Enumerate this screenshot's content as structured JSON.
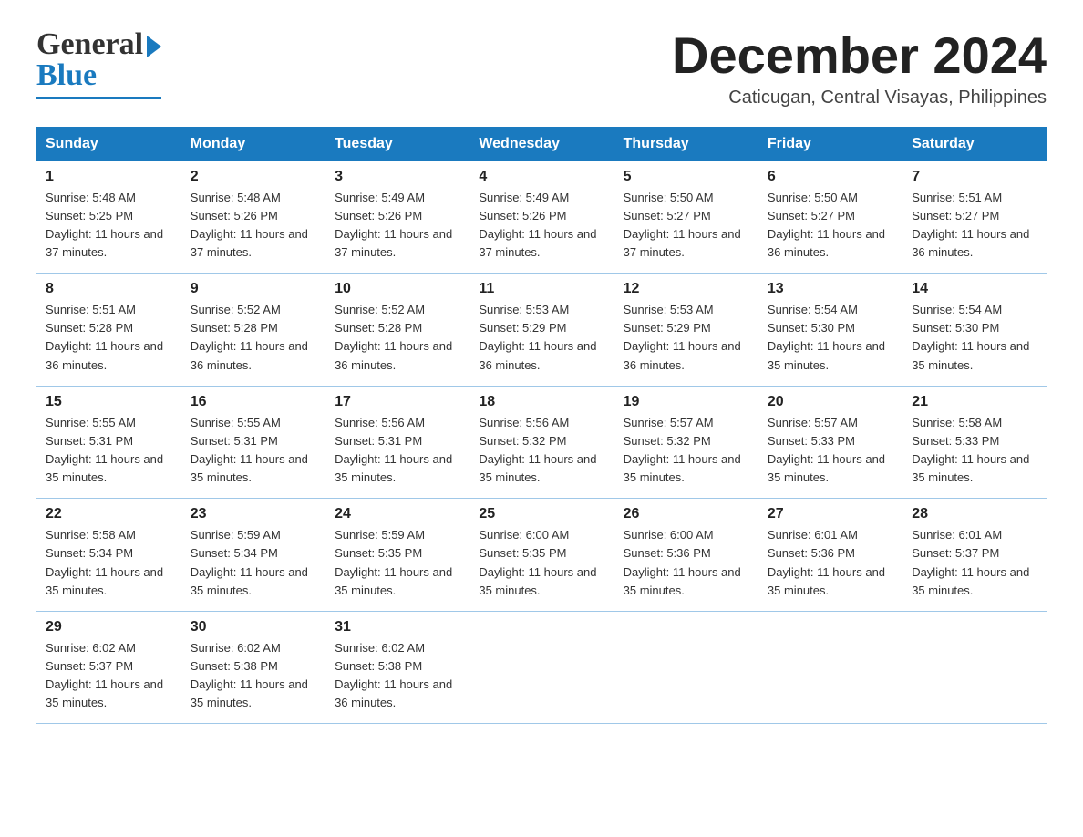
{
  "header": {
    "logo_general": "General",
    "logo_blue": "Blue",
    "month_title": "December 2024",
    "location": "Caticugan, Central Visayas, Philippines"
  },
  "columns": [
    "Sunday",
    "Monday",
    "Tuesday",
    "Wednesday",
    "Thursday",
    "Friday",
    "Saturday"
  ],
  "weeks": [
    [
      {
        "day": "1",
        "sunrise": "5:48 AM",
        "sunset": "5:25 PM",
        "daylight": "11 hours and 37 minutes."
      },
      {
        "day": "2",
        "sunrise": "5:48 AM",
        "sunset": "5:26 PM",
        "daylight": "11 hours and 37 minutes."
      },
      {
        "day": "3",
        "sunrise": "5:49 AM",
        "sunset": "5:26 PM",
        "daylight": "11 hours and 37 minutes."
      },
      {
        "day": "4",
        "sunrise": "5:49 AM",
        "sunset": "5:26 PM",
        "daylight": "11 hours and 37 minutes."
      },
      {
        "day": "5",
        "sunrise": "5:50 AM",
        "sunset": "5:27 PM",
        "daylight": "11 hours and 37 minutes."
      },
      {
        "day": "6",
        "sunrise": "5:50 AM",
        "sunset": "5:27 PM",
        "daylight": "11 hours and 36 minutes."
      },
      {
        "day": "7",
        "sunrise": "5:51 AM",
        "sunset": "5:27 PM",
        "daylight": "11 hours and 36 minutes."
      }
    ],
    [
      {
        "day": "8",
        "sunrise": "5:51 AM",
        "sunset": "5:28 PM",
        "daylight": "11 hours and 36 minutes."
      },
      {
        "day": "9",
        "sunrise": "5:52 AM",
        "sunset": "5:28 PM",
        "daylight": "11 hours and 36 minutes."
      },
      {
        "day": "10",
        "sunrise": "5:52 AM",
        "sunset": "5:28 PM",
        "daylight": "11 hours and 36 minutes."
      },
      {
        "day": "11",
        "sunrise": "5:53 AM",
        "sunset": "5:29 PM",
        "daylight": "11 hours and 36 minutes."
      },
      {
        "day": "12",
        "sunrise": "5:53 AM",
        "sunset": "5:29 PM",
        "daylight": "11 hours and 36 minutes."
      },
      {
        "day": "13",
        "sunrise": "5:54 AM",
        "sunset": "5:30 PM",
        "daylight": "11 hours and 35 minutes."
      },
      {
        "day": "14",
        "sunrise": "5:54 AM",
        "sunset": "5:30 PM",
        "daylight": "11 hours and 35 minutes."
      }
    ],
    [
      {
        "day": "15",
        "sunrise": "5:55 AM",
        "sunset": "5:31 PM",
        "daylight": "11 hours and 35 minutes."
      },
      {
        "day": "16",
        "sunrise": "5:55 AM",
        "sunset": "5:31 PM",
        "daylight": "11 hours and 35 minutes."
      },
      {
        "day": "17",
        "sunrise": "5:56 AM",
        "sunset": "5:31 PM",
        "daylight": "11 hours and 35 minutes."
      },
      {
        "day": "18",
        "sunrise": "5:56 AM",
        "sunset": "5:32 PM",
        "daylight": "11 hours and 35 minutes."
      },
      {
        "day": "19",
        "sunrise": "5:57 AM",
        "sunset": "5:32 PM",
        "daylight": "11 hours and 35 minutes."
      },
      {
        "day": "20",
        "sunrise": "5:57 AM",
        "sunset": "5:33 PM",
        "daylight": "11 hours and 35 minutes."
      },
      {
        "day": "21",
        "sunrise": "5:58 AM",
        "sunset": "5:33 PM",
        "daylight": "11 hours and 35 minutes."
      }
    ],
    [
      {
        "day": "22",
        "sunrise": "5:58 AM",
        "sunset": "5:34 PM",
        "daylight": "11 hours and 35 minutes."
      },
      {
        "day": "23",
        "sunrise": "5:59 AM",
        "sunset": "5:34 PM",
        "daylight": "11 hours and 35 minutes."
      },
      {
        "day": "24",
        "sunrise": "5:59 AM",
        "sunset": "5:35 PM",
        "daylight": "11 hours and 35 minutes."
      },
      {
        "day": "25",
        "sunrise": "6:00 AM",
        "sunset": "5:35 PM",
        "daylight": "11 hours and 35 minutes."
      },
      {
        "day": "26",
        "sunrise": "6:00 AM",
        "sunset": "5:36 PM",
        "daylight": "11 hours and 35 minutes."
      },
      {
        "day": "27",
        "sunrise": "6:01 AM",
        "sunset": "5:36 PM",
        "daylight": "11 hours and 35 minutes."
      },
      {
        "day": "28",
        "sunrise": "6:01 AM",
        "sunset": "5:37 PM",
        "daylight": "11 hours and 35 minutes."
      }
    ],
    [
      {
        "day": "29",
        "sunrise": "6:02 AM",
        "sunset": "5:37 PM",
        "daylight": "11 hours and 35 minutes."
      },
      {
        "day": "30",
        "sunrise": "6:02 AM",
        "sunset": "5:38 PM",
        "daylight": "11 hours and 35 minutes."
      },
      {
        "day": "31",
        "sunrise": "6:02 AM",
        "sunset": "5:38 PM",
        "daylight": "11 hours and 36 minutes."
      },
      {
        "day": "",
        "sunrise": "",
        "sunset": "",
        "daylight": ""
      },
      {
        "day": "",
        "sunrise": "",
        "sunset": "",
        "daylight": ""
      },
      {
        "day": "",
        "sunrise": "",
        "sunset": "",
        "daylight": ""
      },
      {
        "day": "",
        "sunrise": "",
        "sunset": "",
        "daylight": ""
      }
    ]
  ]
}
